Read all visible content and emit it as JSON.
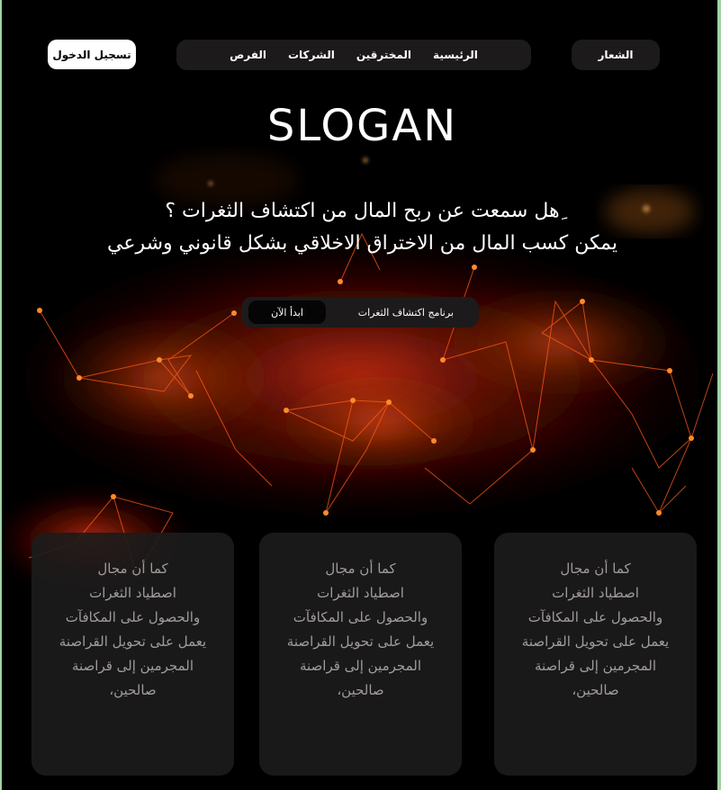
{
  "nav": {
    "login_label": "تسجيل الدخول",
    "links": [
      "الرئيسية",
      "المخترقين",
      "الشركات",
      "الفرص"
    ],
    "logo_label": "الشعار"
  },
  "hero": {
    "slogan": "SLOGAN",
    "headline_1": "ِهل سمعت عن ربح المال من اكتشاف الثغرات ؟",
    "headline_2": "يمكن كسب المال من الاختراق الاخلاقي بشكل قانوني وشرعي",
    "cta_program_label": "برنامج اكتشاف الثغرات",
    "cta_start_label": "ابدأ الآن"
  },
  "cards": [
    {
      "lines": [
        "كما أن مجال",
        "اصطياد الثغرات",
        "والحصول على المكافآت",
        "يعمل على تحويل القراصنة",
        "المجرمين إلى قراصنة",
        "صالحين،"
      ]
    },
    {
      "lines": [
        "كما أن مجال",
        "اصطياد الثغرات",
        "والحصول على المكافآت",
        "يعمل على تحويل القراصنة",
        "المجرمين إلى قراصنة",
        "صالحين،"
      ]
    },
    {
      "lines": [
        "كما أن مجال",
        "اصطياد الثغرات",
        "والحصول على المكافآت",
        "يعمل على تحويل القراصنة",
        "المجرمين إلى قراصنة",
        "صالحين،"
      ]
    }
  ],
  "colors": {
    "background": "#000000",
    "pill": "#1c1a1a",
    "accent_orange": "#ff7a1a",
    "accent_red": "#d01810",
    "card_text": "#a19b9b"
  }
}
